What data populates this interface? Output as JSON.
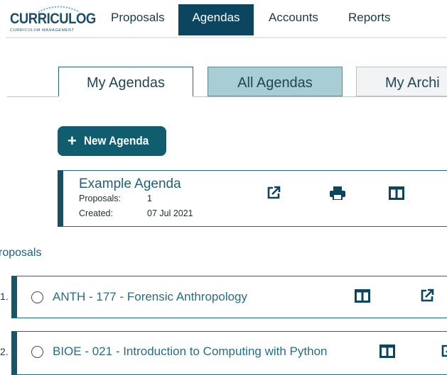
{
  "brand": {
    "name": "CURRICULOG",
    "tagline": "CURRICULUM MANAGEMENT"
  },
  "nav": {
    "items": [
      {
        "label": "Proposals",
        "active": false
      },
      {
        "label": "Agendas",
        "active": true
      },
      {
        "label": "Accounts",
        "active": false
      },
      {
        "label": "Reports",
        "active": false
      }
    ]
  },
  "tabs": [
    {
      "label": "My Agendas",
      "selected": true
    },
    {
      "label": "All Agendas",
      "selected": false
    },
    {
      "label": "My Archi",
      "selected": false
    }
  ],
  "new_agenda_button": {
    "label": "New Agenda",
    "icon": "plus-icon"
  },
  "agenda": {
    "title": "Example Agenda",
    "proposals_label": "Proposals:",
    "proposals_value": "1",
    "created_label": "Created:",
    "created_value": "07 Jul 2021",
    "actions": [
      "external-link-icon",
      "print-icon",
      "columns-icon"
    ]
  },
  "proposals_section": {
    "heading": "roposals",
    "items": [
      {
        "number": "1.",
        "title": "ANTH - 177 - Forensic Anthropology"
      },
      {
        "number": "2.",
        "title": "BIOE - 021 - Introduction to Computing with Python"
      }
    ]
  },
  "colors": {
    "primary": "#0c4560",
    "accent": "#0f5d6e",
    "tab_active_bg": "#a9cdd4",
    "link": "#246e85"
  }
}
